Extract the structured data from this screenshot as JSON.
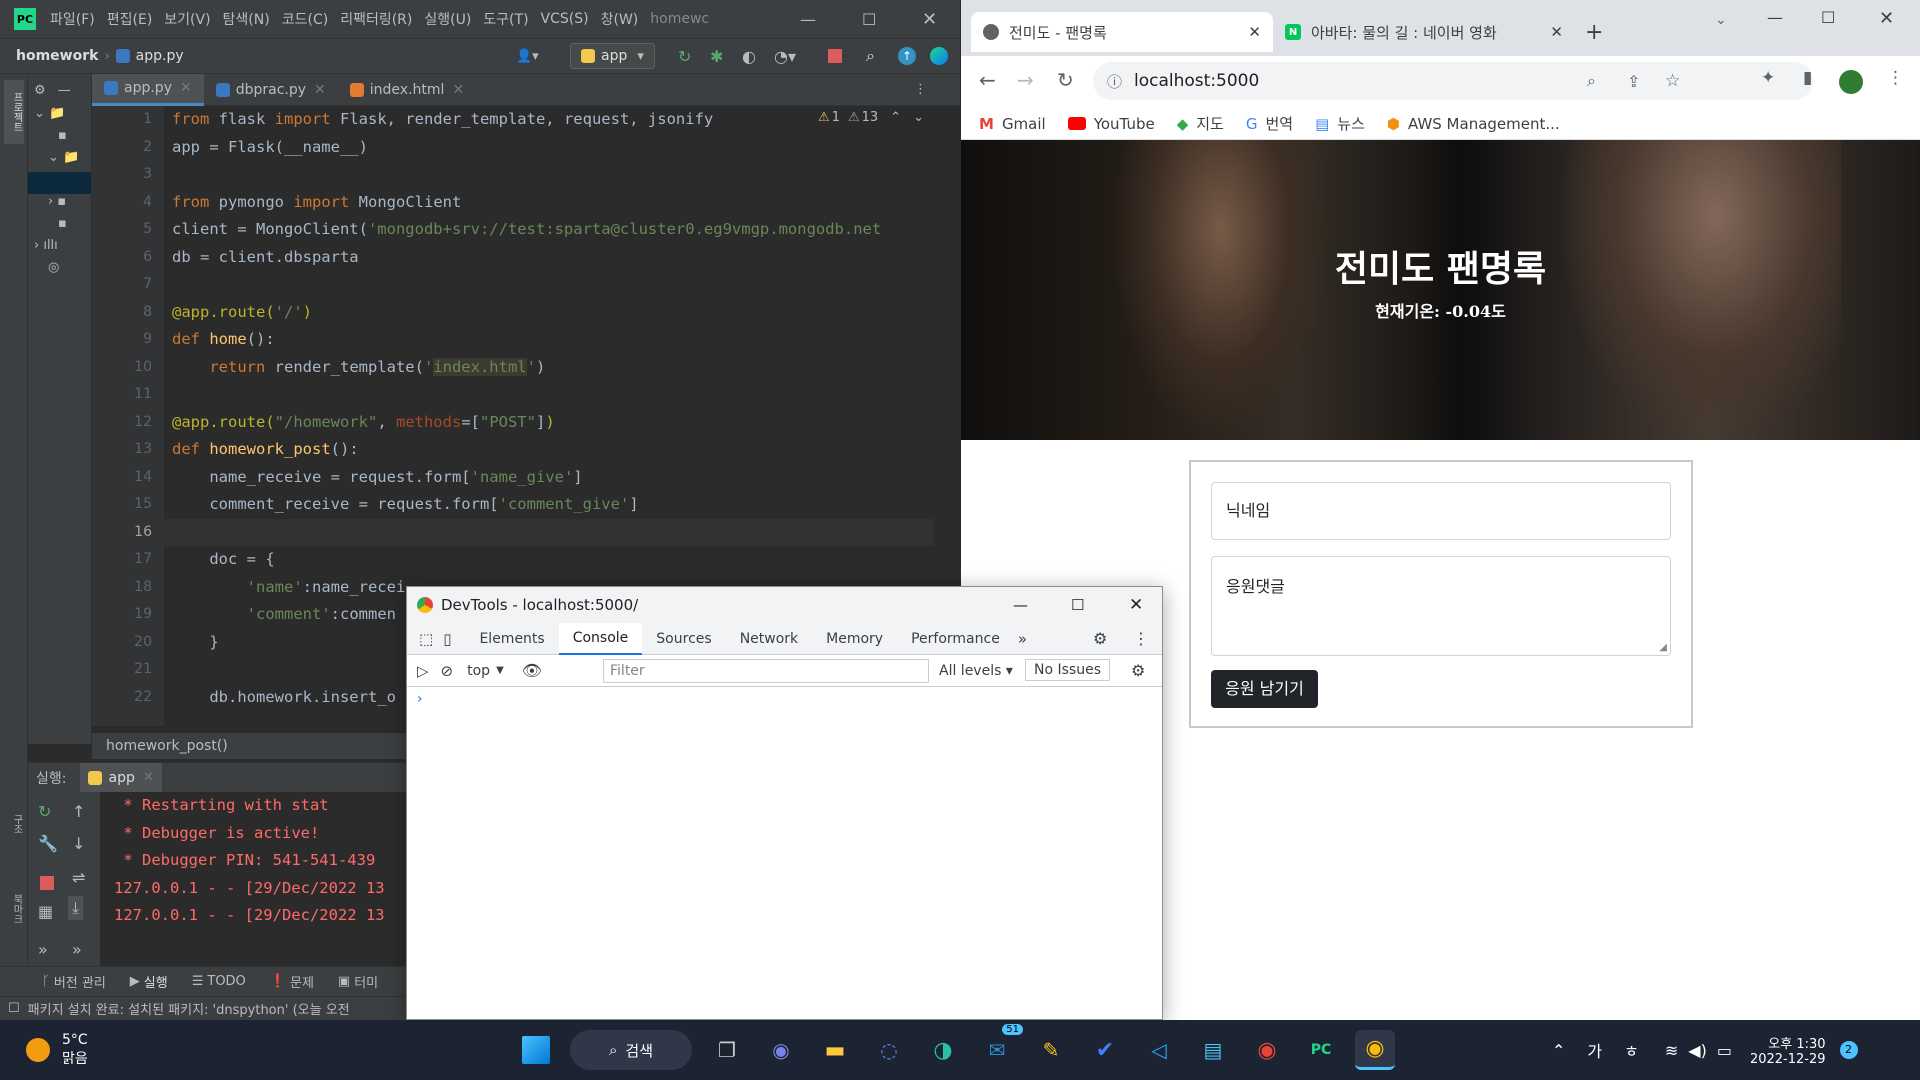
{
  "ide": {
    "project_name": "homework",
    "current_file": "app.py",
    "menu": [
      "파일(F)",
      "편집(E)",
      "보기(V)",
      "탐색(N)",
      "코드(C)",
      "리팩터링(R)",
      "실행(U)",
      "도구(T)",
      "VCS(S)",
      "창(W)",
      "homewc"
    ],
    "run_config": "app",
    "editor_tabs": [
      "app.py",
      "dbprac.py",
      "index.html"
    ],
    "inspections": {
      "warnings": "1",
      "weak_warnings": "13"
    },
    "line_numbers": [
      "1",
      "2",
      "3",
      "4",
      "5",
      "6",
      "7",
      "8",
      "9",
      "10",
      "11",
      "12",
      "13",
      "14",
      "15",
      "16",
      "17",
      "18",
      "19",
      "20",
      "21",
      "22"
    ],
    "breadcrumb": "homework_post()",
    "run_label": "실행:",
    "run_tab": "app",
    "console_lines": [
      "* Restarting with stat",
      "* Debugger is active!",
      "* Debugger PIN: 541-541-439",
      "127.0.0.1 - - [29/Dec/2022 13",
      "127.0.0.1 - - [29/Dec/2022 13"
    ],
    "bottom_tabs": [
      "버전 관리",
      "실행",
      "TODO",
      "문제",
      "터미"
    ],
    "status_text": "패키지 설치 완료: 설치된 패키지: 'dnspython' (오늘 오전"
  },
  "chrome": {
    "tabs": [
      "전미도 - 팬명록",
      "아바타: 물의 길 : 네이버 영화"
    ],
    "url": "localhost:5000",
    "bookmarks": [
      "Gmail",
      "YouTube",
      "지도",
      "번역",
      "뉴스",
      "AWS Management..."
    ],
    "page": {
      "title": "전미도 팬명록",
      "temperature": "현재기온: -0.04도",
      "nickname_placeholder": "닉네임",
      "comment_placeholder": "응원댓글",
      "submit_label": "응원 남기기"
    }
  },
  "devtools": {
    "title": "DevTools - localhost:5000/",
    "tabs": [
      "Elements",
      "Console",
      "Sources",
      "Network",
      "Memory",
      "Performance"
    ],
    "active_tab": "Console",
    "context": "top",
    "filter_placeholder": "Filter",
    "levels": "All levels",
    "issues": "No Issues"
  },
  "taskbar": {
    "weather_temp": "5°C",
    "weather_desc": "맑음",
    "search_label": "검색",
    "badge_count": "51",
    "ime": "가",
    "time": "오후 1:30",
    "date": "2022-12-29",
    "notifications": "2"
  }
}
